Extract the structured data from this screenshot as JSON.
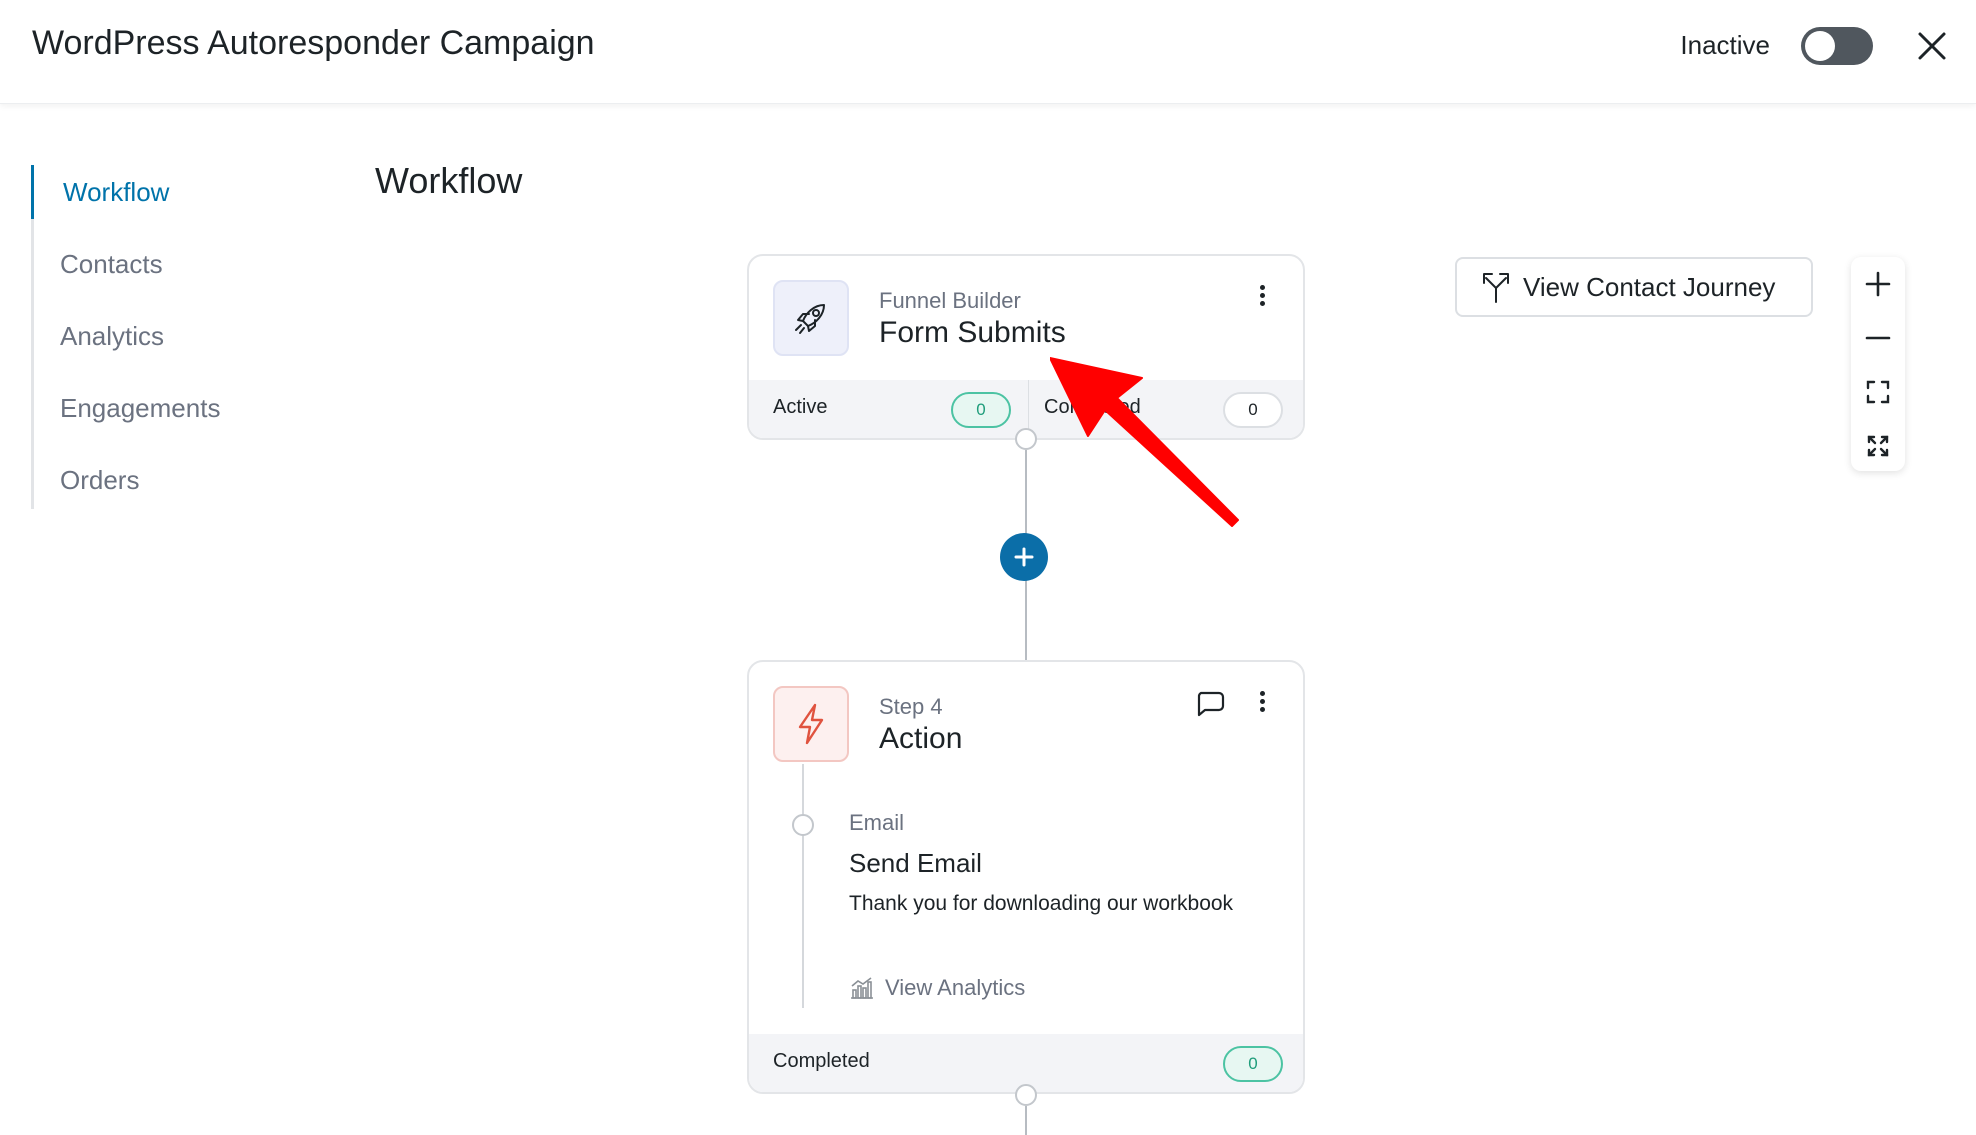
{
  "header": {
    "title": "WordPress Autoresponder Campaign",
    "status_label": "Inactive",
    "toggle_state": "off"
  },
  "sidebar": {
    "items": [
      {
        "label": "Workflow",
        "active": true
      },
      {
        "label": "Contacts",
        "active": false
      },
      {
        "label": "Analytics",
        "active": false
      },
      {
        "label": "Engagements",
        "active": false
      },
      {
        "label": "Orders",
        "active": false
      }
    ]
  },
  "main": {
    "title": "Workflow",
    "trigger": {
      "subtitle": "Funnel Builder",
      "title": "Form Submits",
      "icon": "rocket-icon",
      "footer": {
        "active_label": "Active",
        "active_count": "0",
        "completed_label": "Completed",
        "completed_count": "0"
      }
    },
    "step": {
      "subtitle": "Step 4",
      "title": "Action",
      "icon": "lightning-icon",
      "action": {
        "type_label": "Email",
        "title": "Send Email",
        "description": "Thank you for downloading our workbook",
        "analytics_link": "View Analytics"
      },
      "footer": {
        "completed_label": "Completed",
        "completed_count": "0"
      }
    }
  },
  "toolbar": {
    "journey_button": "View Contact Journey"
  },
  "colors": {
    "accent": "#0073aa",
    "add_node": "#0b6ea8",
    "success": "#4cc3a3",
    "annotation": "#ff0000"
  }
}
